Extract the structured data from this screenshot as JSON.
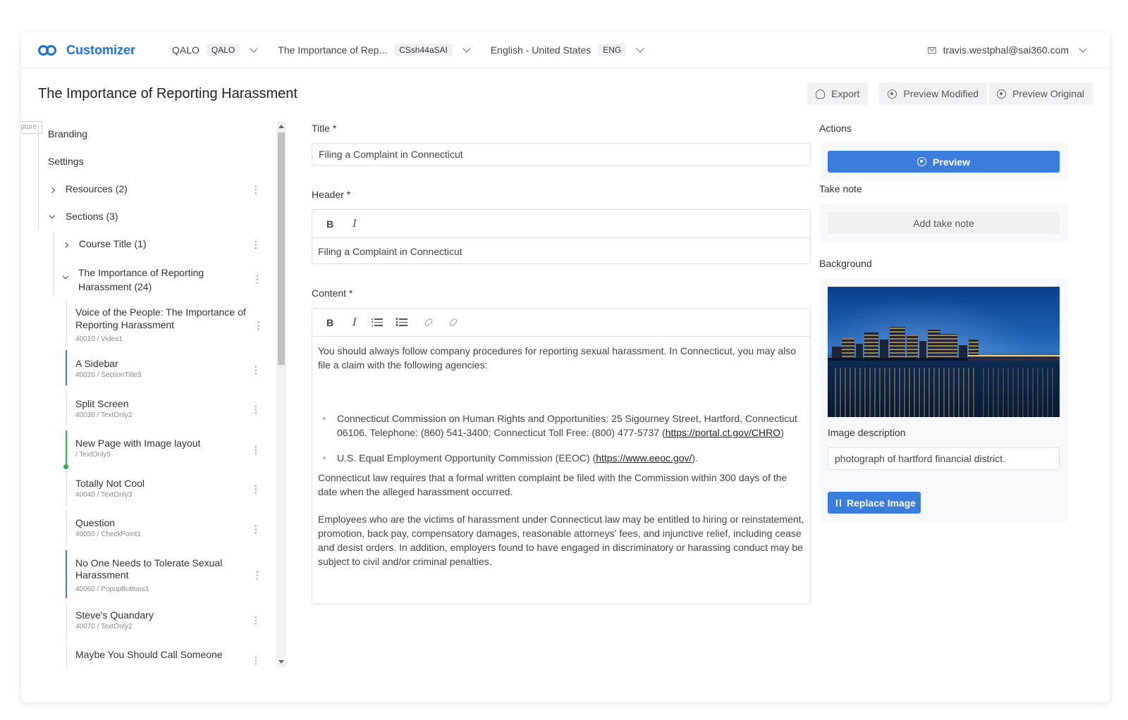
{
  "app": {
    "name": "Customizer",
    "user_email": "travis.westphal@sai360.com"
  },
  "selectors": [
    {
      "label": "QALO",
      "tag": "QALO"
    },
    {
      "label": "The Importance of Rep...",
      "tag": "CSsh44aSAI"
    },
    {
      "label": "English - United States",
      "tag": "ENG"
    }
  ],
  "page": {
    "title": "The Importance of Reporting Harassment"
  },
  "header_buttons": {
    "export": "Export",
    "preview_modified": "Preview Modified",
    "preview_original": "Preview Original"
  },
  "tree": {
    "tab_label": "pture",
    "branding": "Branding",
    "settings": "Settings",
    "resources": "Resources (2)",
    "sections": "Sections (3)",
    "course_title": "Course Title (1)",
    "importance": "The Importance of Reporting Harassment (24)",
    "pages": [
      {
        "title": "Voice of the People: The Importance of Reporting Harassment",
        "sub": "40010 / Video1"
      },
      {
        "title": "A Sidebar",
        "sub": "40020 / SectionTitle3"
      },
      {
        "title": "Split Screen",
        "sub": "40030 / TextOnly2"
      },
      {
        "title": "New Page with Image layout",
        "sub": "/ TextOnly5"
      },
      {
        "title": "Totally Not Cool",
        "sub": "40040 / TextOnly3"
      },
      {
        "title": "Question",
        "sub": "40050 / CheckPoint1"
      },
      {
        "title": "No One Needs to Tolerate Sexual Harassment",
        "sub": "40060 / PopupButtons1"
      },
      {
        "title": "Steve's Quandary",
        "sub": "40070 / TextOnly2"
      },
      {
        "title": "Maybe You Should Call Someone",
        "sub": ""
      }
    ]
  },
  "form": {
    "title_label": "Title *",
    "title_value": "Filing a Complaint in Connecticut",
    "header_label": "Header *",
    "header_value": "Filing a Complaint in Connecticut",
    "content_label": "Content *",
    "content": {
      "intro": "You should always follow company procedures for reporting sexual harassment. In Connecticut, you may also file a claim with the following agencies:",
      "bullet1_text": "Connecticut Commission on Human Rights and Opportunities: 25 Sigourney Street, Hartford, Connecticut 06106. Telephone: (860) 541-3400; Connecticut Toll Free: (800) 477-5737 (",
      "bullet1_link": "https://portal.ct.gov/CHRO",
      "bullet1_end": ")",
      "bullet2_text": "U.S. Equal Employment Opportunity Commission (EEOC) (",
      "bullet2_link": "https://www.eeoc.gov/",
      "bullet2_end": ").",
      "para2": "Connecticut law requires that a formal written complaint be filed with the Commission within 300 days of the date when the alleged harassment occurred.",
      "para3": "Employees who are the victims of harassment under Connecticut law may be entitled to hiring or reinstatement, promotion, back pay, compensatory damages, reasonable attorneys' fees, and injunctive relief, including cease and desist orders. In addition, employers found to have engaged in discriminatory or harassing conduct may be subject to civil and/or criminal penalties."
    }
  },
  "panel": {
    "actions_label": "Actions",
    "preview_button": "Preview",
    "take_note_label": "Take note",
    "add_take_note": "Add take note",
    "background_label": "Background",
    "image_description_label": "Image description",
    "image_description_value": "photograph of hartford financial district.",
    "replace_image": "Replace Image"
  }
}
